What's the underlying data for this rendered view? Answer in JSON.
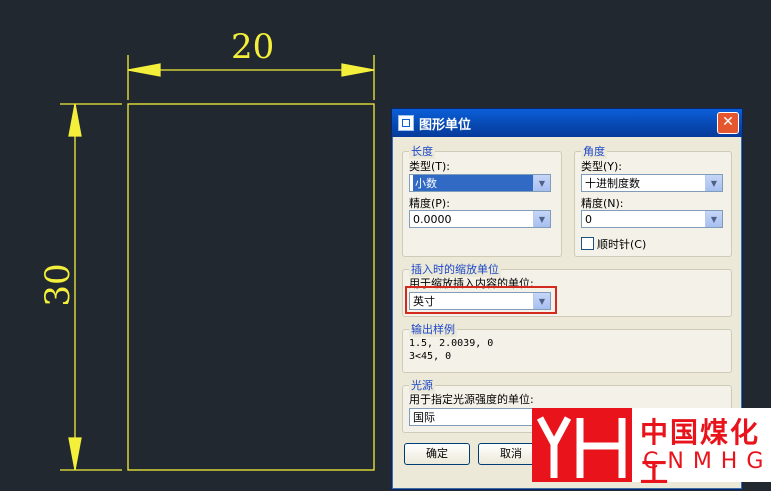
{
  "drawing": {
    "width_dim": "20",
    "height_dim": "30",
    "line_color": "#f4ef3a"
  },
  "dialog": {
    "title": "图形单位",
    "close_glyph": "✕",
    "length": {
      "legend": "长度",
      "type_label": "类型(T):",
      "type_value": "小数",
      "precision_label": "精度(P):",
      "precision_value": "0.0000"
    },
    "angle": {
      "legend": "角度",
      "type_label": "类型(Y):",
      "type_value": "十进制度数",
      "precision_label": "精度(N):",
      "precision_value": "0",
      "clockwise_label": "顺时针(C)",
      "clockwise_checked": false
    },
    "insert_scale": {
      "legend": "插入时的缩放单位",
      "label": "用于缩放插入内容的单位:",
      "value": "英寸"
    },
    "sample": {
      "legend": "输出样例",
      "line1": "1.5, 2.0039, 0",
      "line2": "3<45, 0"
    },
    "lighting": {
      "legend": "光源",
      "label": "用于指定光源强度的单位:",
      "value": "国际"
    },
    "buttons": {
      "ok": "确定",
      "cancel": "取消"
    }
  },
  "watermark": {
    "cn": "中国煤化工",
    "en": "CNMHG",
    "color": "#e8131b"
  }
}
